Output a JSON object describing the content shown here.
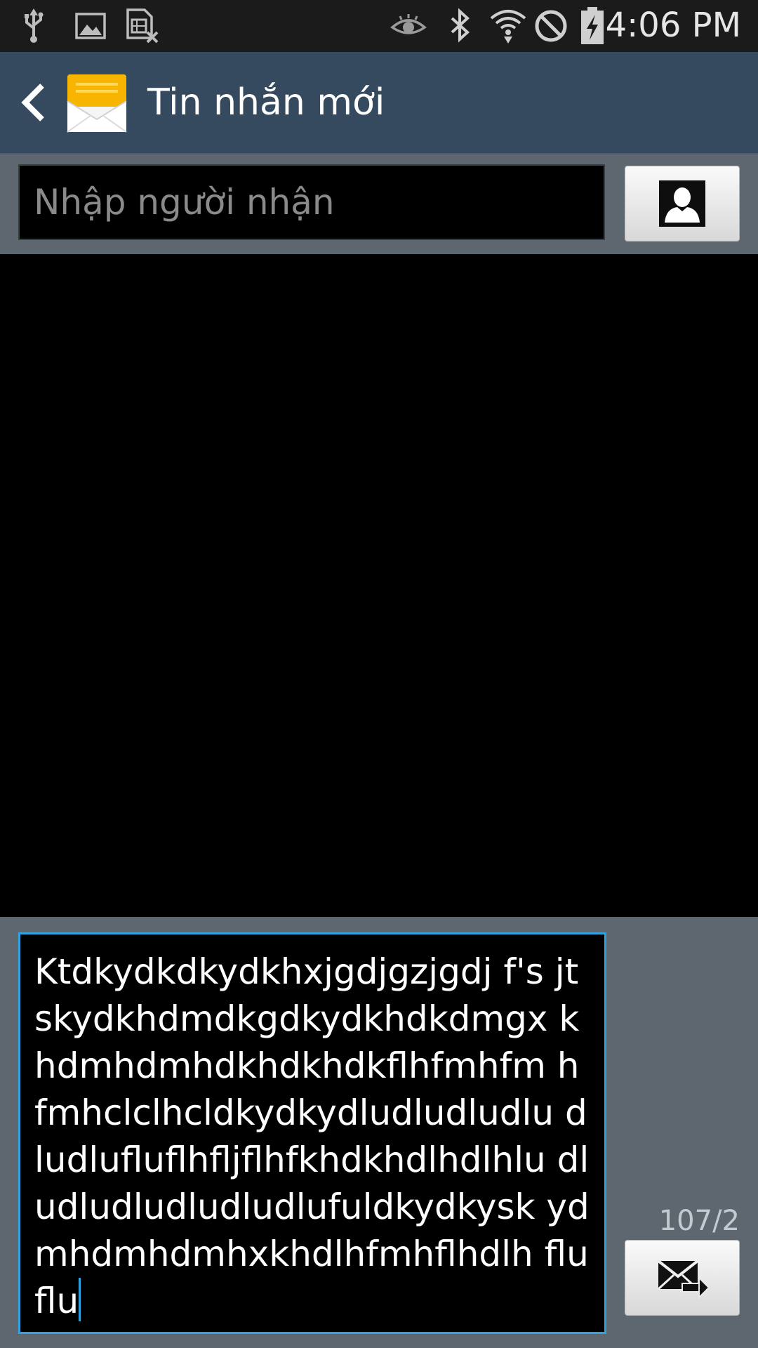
{
  "status_bar": {
    "time": "4:06 PM",
    "icons": [
      "usb-icon",
      "image-icon",
      "sim-error-icon",
      "eye-icon",
      "bluetooth-icon",
      "wifi-icon",
      "blocked-icon",
      "battery-charging-icon"
    ]
  },
  "action_bar": {
    "title": "Tin nhắn mới",
    "back_icon": "back-arrow-icon",
    "app_icon": "envelope-icon",
    "accent": "#35495f"
  },
  "recipient": {
    "placeholder": "Nhập người nhận",
    "value": "",
    "contact_button_icon": "contact-icon"
  },
  "compose": {
    "message": "Ktdkydkdkydkhxjgdjgzjgdj f's jtskydkhdmdkgdkydkhdkdmgx khdmhdmhdkhdkhdkflhfmhfm hfmhclclhcldkydkydludludludlu dludlufluflhfljflhfkhdkhdlhdlhlu dludludludludludlufuldkydkysk ydmhdmhdmhxkhdlhfmhflhdlh fluflu",
    "counter": "107/2",
    "send_button_icon": "send-message-icon",
    "focus_color": "#2ea3e2"
  }
}
